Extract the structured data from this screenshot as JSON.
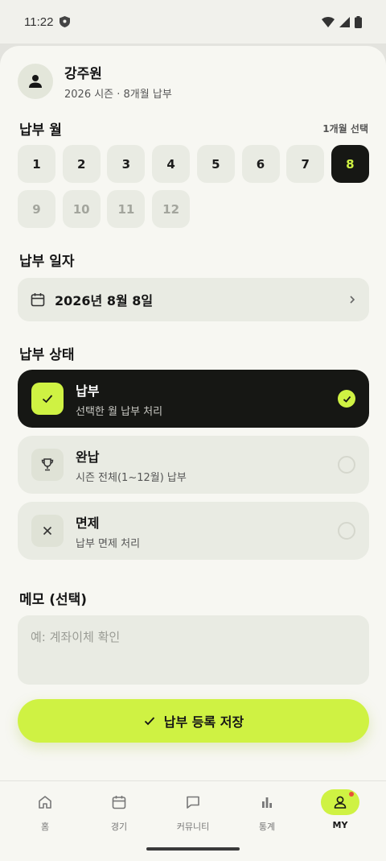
{
  "status_bar": {
    "time": "11:22"
  },
  "profile": {
    "name": "강주원",
    "subtitle": "2026 시즌 · 8개월 납부"
  },
  "month_section": {
    "title": "납부 월",
    "selected_count_label": "1개월 선택",
    "months": [
      {
        "label": "1",
        "state": "normal"
      },
      {
        "label": "2",
        "state": "normal"
      },
      {
        "label": "3",
        "state": "normal"
      },
      {
        "label": "4",
        "state": "normal"
      },
      {
        "label": "5",
        "state": "normal"
      },
      {
        "label": "6",
        "state": "normal"
      },
      {
        "label": "7",
        "state": "normal"
      },
      {
        "label": "8",
        "state": "selected"
      },
      {
        "label": "9",
        "state": "disabled"
      },
      {
        "label": "10",
        "state": "disabled"
      },
      {
        "label": "11",
        "state": "disabled"
      },
      {
        "label": "12",
        "state": "disabled"
      }
    ]
  },
  "date_section": {
    "title": "납부 일자",
    "value": "2026년 8월 8일"
  },
  "status_section": {
    "title": "납부 상태",
    "options": [
      {
        "title": "납부",
        "desc": "선택한 월 납부 처리",
        "icon": "check-icon",
        "selected": true
      },
      {
        "title": "완납",
        "desc": "시즌 전체(1~12월) 납부",
        "icon": "trophy-icon",
        "selected": false
      },
      {
        "title": "면제",
        "desc": "납부 면제 처리",
        "icon": "close-icon",
        "selected": false
      }
    ]
  },
  "memo_section": {
    "title": "메모 (선택)",
    "placeholder": "예: 계좌이체 확인",
    "value": ""
  },
  "save_button": {
    "label": "납부 등록 저장"
  },
  "bottom_nav": {
    "items": [
      {
        "label": "홈",
        "icon": "home-icon",
        "active": false
      },
      {
        "label": "경기",
        "icon": "calendar-icon",
        "active": false
      },
      {
        "label": "커뮤니티",
        "icon": "chat-icon",
        "active": false
      },
      {
        "label": "통계",
        "icon": "bar-chart-icon",
        "active": false
      },
      {
        "label": "MY",
        "icon": "person-icon",
        "active": true
      }
    ]
  },
  "colors": {
    "accent": "#cff243",
    "dark": "#161714",
    "card": "#e9ebe3",
    "background": "#f7f7f2",
    "badge": "#e8503a"
  }
}
